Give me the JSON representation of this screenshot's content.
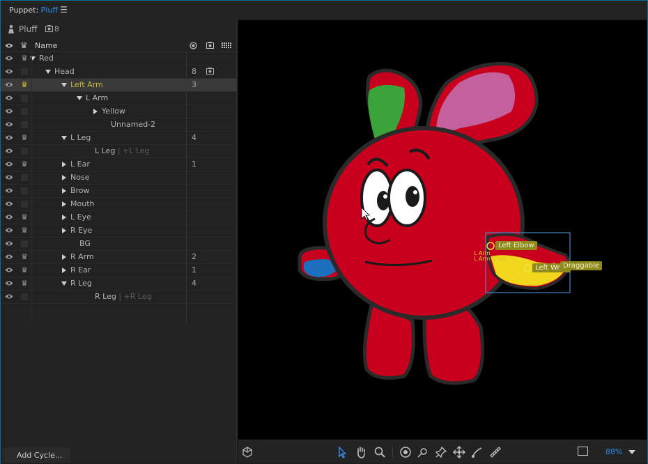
{
  "panel": {
    "title_prefix": "Puppet:",
    "title_name": "Pluff",
    "menu_icon": "hamburger-icon"
  },
  "puppet": {
    "name": "Pluff",
    "count": "8"
  },
  "columns": {
    "name": "Name"
  },
  "rows": [
    {
      "label": "Red",
      "level": 1,
      "toggle": "down",
      "crown": true,
      "num": ""
    },
    {
      "label": "Head",
      "level": 2,
      "toggle": "down",
      "crown": false,
      "num": "8"
    },
    {
      "label": "Left Arm",
      "level": 3,
      "toggle": "down",
      "crown": true,
      "num": "3",
      "selected": true
    },
    {
      "label": "L Arm",
      "level": 4,
      "toggle": "down",
      "crown": false,
      "num": ""
    },
    {
      "label": "Yellow",
      "level": 5,
      "toggle": "right",
      "crown": false,
      "num": ""
    },
    {
      "label": "Unnamed-2",
      "level": 5,
      "toggle": "",
      "crown": false,
      "num": ""
    },
    {
      "label": "L Leg",
      "level": 3,
      "toggle": "down",
      "crown": true,
      "num": "4"
    },
    {
      "label": "L Leg",
      "tag": "| +L Leg",
      "level": 4,
      "toggle": "",
      "crown": false,
      "num": ""
    },
    {
      "label": "L Ear",
      "level": 3,
      "toggle": "right",
      "crown": true,
      "num": "1"
    },
    {
      "label": "Nose",
      "level": 3,
      "toggle": "right",
      "crown": false,
      "num": ""
    },
    {
      "label": "Brow",
      "level": 3,
      "toggle": "right",
      "crown": false,
      "num": ""
    },
    {
      "label": "Mouth",
      "level": 3,
      "toggle": "right",
      "crown": false,
      "num": ""
    },
    {
      "label": "L Eye",
      "level": 3,
      "toggle": "right",
      "crown": true,
      "num": ""
    },
    {
      "label": "R Eye",
      "level": 3,
      "toggle": "right",
      "crown": true,
      "num": ""
    },
    {
      "label": "BG",
      "level": 3,
      "toggle": "",
      "crown": false,
      "num": ""
    },
    {
      "label": "R Arm",
      "level": 3,
      "toggle": "right",
      "crown": true,
      "num": "2"
    },
    {
      "label": "R Ear",
      "level": 3,
      "toggle": "right",
      "crown": true,
      "num": "1"
    },
    {
      "label": "R Leg",
      "level": 3,
      "toggle": "down",
      "crown": true,
      "num": "4"
    },
    {
      "label": "R Leg",
      "tag": "| +R Leg",
      "level": 4,
      "toggle": "",
      "crown": false,
      "num": ""
    }
  ],
  "buttons": {
    "add_cycle": "Add Cycle..."
  },
  "canvas": {
    "handles": {
      "left_elbow": "Left Elbow",
      "left_wrist": "Left Wrist",
      "draggable": "Draggable",
      "l_arm": "L Arm",
      "l_arm_shape": "L Arm Shape"
    }
  },
  "toolbar": {
    "zoom": "88%",
    "tools": [
      "select-tool-icon",
      "hand-tool-icon",
      "zoom-tool-icon",
      "origin-tool-icon",
      "handle-tool-icon",
      "pin-tool-icon",
      "dragger-tool-icon",
      "stick-tool-icon",
      "ruler-tool-icon"
    ]
  },
  "colors": {
    "accent": "#2d8ceb",
    "selected_text": "#c9b23a",
    "body_red": "#c8001e",
    "arm_yellow": "#f2d81c",
    "ear_green": "#3aa43a",
    "ear_pink": "#c4609c",
    "arm_blue": "#1c6fbd"
  }
}
